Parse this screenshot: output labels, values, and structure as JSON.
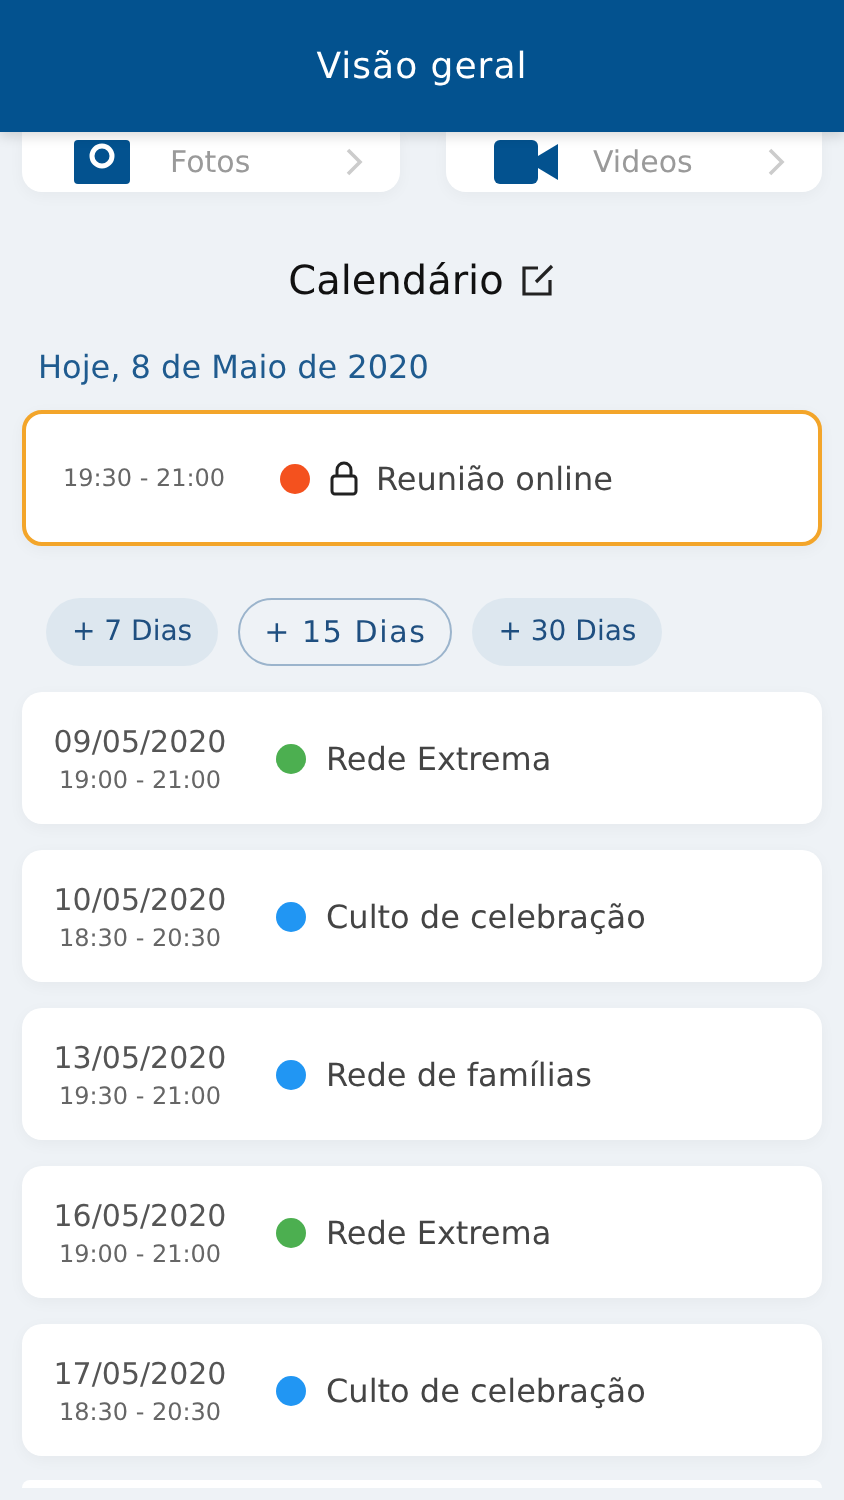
{
  "header": {
    "title": "Visão geral"
  },
  "media": [
    {
      "kind": "photos",
      "label": "Fotos"
    },
    {
      "kind": "videos",
      "label": "Videos"
    }
  ],
  "calendar": {
    "title": "Calendário",
    "today": "Hoje, 8 de Maio de 2020",
    "today_events": [
      {
        "time": "19:30 - 21:00",
        "color": "#f4511e",
        "locked": true,
        "title": "Reunião online"
      }
    ],
    "ranges": [
      {
        "label": "+ 7 Dias",
        "selected": false
      },
      {
        "label": "+ 15 Dias",
        "selected": true
      },
      {
        "label": "+ 30 Dias",
        "selected": false
      }
    ],
    "events": [
      {
        "date": "09/05/2020",
        "time": "19:00 - 21:00",
        "color": "#4caf50",
        "title": "Rede Extrema"
      },
      {
        "date": "10/05/2020",
        "time": "18:30 - 20:30",
        "color": "#2196f3",
        "title": "Culto de celebração"
      },
      {
        "date": "13/05/2020",
        "time": "19:30 - 21:00",
        "color": "#2196f3",
        "title": "Rede de famílias"
      },
      {
        "date": "16/05/2020",
        "time": "19:00 - 21:00",
        "color": "#4caf50",
        "title": "Rede Extrema"
      },
      {
        "date": "17/05/2020",
        "time": "18:30 - 20:30",
        "color": "#2196f3",
        "title": "Culto de celebração"
      }
    ]
  }
}
